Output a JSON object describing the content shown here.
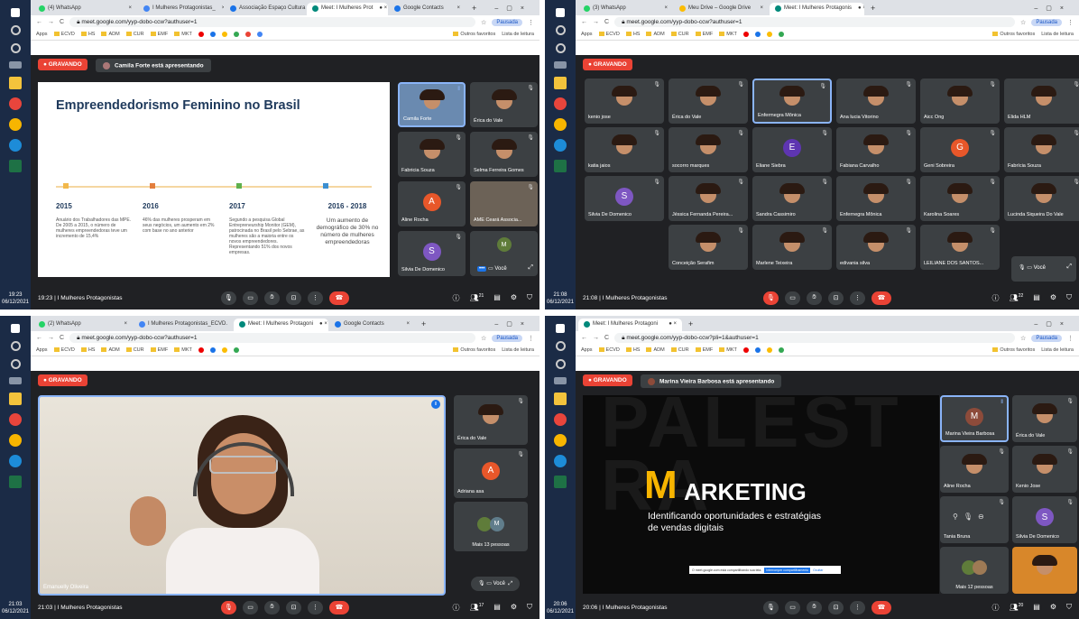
{
  "colors": {
    "record": "#ea4335",
    "meet_bg": "#202124",
    "tile_bg": "#3c4043",
    "taskbar": "#1b2b46",
    "accent_yellow": "#f7b500"
  },
  "browser": {
    "url": "meet.google.com/yyp-dobo-ccw?authuser=1",
    "url_alt": "meet.google.com/yyp-dobo-ccw?pli=1&authuser=1",
    "profile": "Pausada",
    "bookmarks": [
      "Apps",
      "ECVD",
      "HS",
      "ADM",
      "CUR",
      "EMF",
      "MKT"
    ],
    "bookmarks_right": [
      "Outros favoritos",
      "Lista de leitura"
    ]
  },
  "meet": {
    "recording": "GRAVANDO",
    "meeting_name": "I Mulheres Protagonistas",
    "you": "Você"
  },
  "q1": {
    "tabs": [
      "(4) WhatsApp",
      "I Mulheres Protagonistas_",
      "Associação Espaço Cultura",
      "Meet: I Mulheres Prot",
      "Google Contacts"
    ],
    "presenting": "Camila Forte está apresentando",
    "clock": "19:23",
    "date": "06/12/2021",
    "count": "21",
    "slide": {
      "title": "Empreendedorismo Feminino no Brasil",
      "cols": [
        {
          "year": "2015",
          "text": "Anuário dos Trabalhadores das MPE. De 2005 a 2015, o número de mulheres empreendedoras teve um incremento de 15,4%"
        },
        {
          "year": "2016",
          "text": "46% das mulheres prosperam em seus negócios, um aumento em 2% com base no ano anterior"
        },
        {
          "year": "2017",
          "text": "Segundo a pesquisa Global Entrepreneurship Monitor (GEM), patrocinada no Brasil pelo Sebrae, as mulheres são a maioria entre os novos empreendedores. Representando 51% dos novos empresas."
        },
        {
          "year": "2016 - 2018",
          "text": "Um aumento de demográfico de 30% no número de mulheres empreendedoras"
        }
      ]
    },
    "tiles": [
      "Camila Forte",
      "Érica do Vale",
      "Fabricia Souza",
      "Selma Ferreira Gomes",
      "Aline Rocha",
      "AME Ceará Associa...",
      "Silvia De Domenico"
    ],
    "initials": {
      "aline": "A",
      "silvia": "S",
      "m": "M"
    }
  },
  "q2": {
    "tabs": [
      "(3) WhatsApp",
      "Meu Drive – Google Drive",
      "Meet: I Mulheres Protagonis"
    ],
    "clock": "21:08",
    "date": "06/12/2021",
    "count": "22",
    "tiles": [
      "kenio jose",
      "Érica do Vale",
      "Enfermegra Mônica",
      "Ana lucia Vitorino",
      "Aicc Ong",
      "Elida HLM",
      "katia jaios",
      "socorro marques",
      "Eliane Siebra",
      "Fabiana Carvalho",
      "Geni Sobreira",
      "Fabrícia Souza",
      "Silvia De Domenico",
      "Jéssica Fernanda Pereira...",
      "Sandra Cassimiro",
      "Enfernegra Mônica",
      "Karolina Soares",
      "Lucinda Siqueira Do Vale",
      "Conceição Serafim",
      "Marlene Teixeira",
      "edivania silva",
      "LEILIANE DOS SANTOS..."
    ],
    "initials": {
      "eliane": "E",
      "geni": "G",
      "silvia": "S"
    }
  },
  "q3": {
    "tabs": [
      "(2) WhatsApp",
      "I Mulheres Protagonistas_ECVD.",
      "Meet: I Mulheres Protagoni",
      "Google Contacts"
    ],
    "clock": "21:03",
    "date": "06/12/2021",
    "count": "17",
    "main_speaker": "Emanuelly Oliveira",
    "tiles": [
      "Érica do Vale",
      "Adriana asa",
      "Mais 13 pessoas"
    ],
    "initials": {
      "adriana": "A",
      "m": "M"
    }
  },
  "q4": {
    "tabs": [
      "Meet: I Mulheres Protagoni"
    ],
    "presenting": "Marina Vieira Barbosa está apresentando",
    "clock": "20:06",
    "date": "06/12/2021",
    "count": "20",
    "slide": {
      "big_m": "M",
      "word": "ARKETING",
      "subtitle1": "Identificando oportunidades e estratégias",
      "subtitle2": "de vendas digitais",
      "bg_letters": "PALESTRA",
      "share_bar": "O meet.google.com está compartilhando sua tela.",
      "share_btn": "Interromper compartilhamento",
      "hide": "Ocultar"
    },
    "tiles": [
      "Marina Vieira Barbosa",
      "Érica do Vale",
      "Aline Rocha",
      "Kenio Jose",
      "Tania Bruna",
      "Silvia De Domenico",
      "Mais 12 pessoas"
    ],
    "initials": {
      "marina": "M",
      "silvia": "S"
    }
  }
}
